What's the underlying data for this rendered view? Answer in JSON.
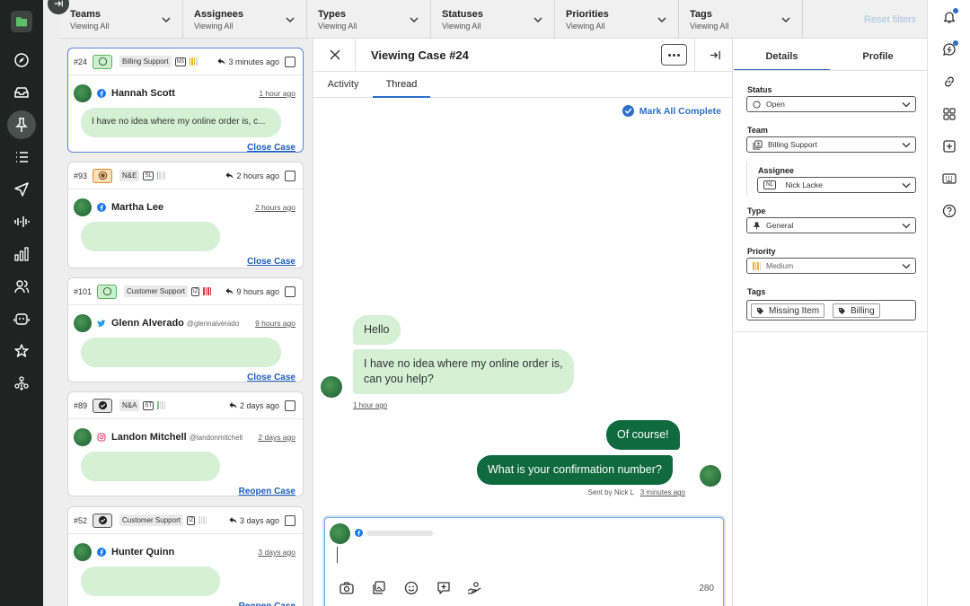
{
  "leftnav": {
    "items": [
      {
        "name": "folder-icon",
        "active": false
      },
      {
        "name": "compass-icon",
        "active": false
      },
      {
        "name": "inbox-icon",
        "active": false
      },
      {
        "name": "pin-icon",
        "active": true
      },
      {
        "name": "list-icon",
        "active": false
      },
      {
        "name": "send-icon",
        "active": false
      },
      {
        "name": "audio-wave-icon",
        "active": false
      },
      {
        "name": "bar-chart-icon",
        "active": false
      },
      {
        "name": "users-icon",
        "active": false
      },
      {
        "name": "bot-icon",
        "active": false
      },
      {
        "name": "star-badge-icon",
        "active": false
      },
      {
        "name": "network-icon",
        "active": false
      }
    ]
  },
  "filters": {
    "items": [
      {
        "title": "Teams",
        "value": "Viewing All"
      },
      {
        "title": "Assignees",
        "value": "Viewing All"
      },
      {
        "title": "Types",
        "value": "Viewing All"
      },
      {
        "title": "Statuses",
        "value": "Viewing All"
      },
      {
        "title": "Priorities",
        "value": "Viewing All"
      },
      {
        "title": "Tags",
        "value": "Viewing All"
      }
    ],
    "reset_label": "Reset filters"
  },
  "cases": [
    {
      "id": "#24",
      "status": "open",
      "team": "Billing Support",
      "initials": "NS",
      "priority_colors": [
        "#e8b530",
        "#e8b530",
        "#e8b530",
        "#d9d9d9"
      ],
      "reply_time": "3 minutes ago",
      "customer": "Hannah Scott",
      "handle": "",
      "channel": "facebook",
      "time": "1 hour ago",
      "preview": "I have no idea where my online order is, c...",
      "action": "Close Case"
    },
    {
      "id": "#93",
      "status": "pending",
      "team": "N&E",
      "initials": "SL",
      "priority_colors": [
        "#7fc28f",
        "#d9d9d9",
        "#d9d9d9",
        "#d9d9d9"
      ],
      "reply_time": "2 hours ago",
      "customer": "Martha Lee",
      "handle": "",
      "channel": "facebook",
      "time": "2 hours ago",
      "preview": "",
      "action": "Close Case"
    },
    {
      "id": "#101",
      "status": "open",
      "team": "Customer Support",
      "initials": "IZ",
      "priority_colors": [
        "#d9363e",
        "#d9363e",
        "#d9363e",
        "#d9363e"
      ],
      "reply_time": "9 hours ago",
      "customer": "Glenn Alverado",
      "handle": "@glennalverado",
      "channel": "twitter",
      "time": "9 hours ago",
      "preview": "",
      "action": "Close Case"
    },
    {
      "id": "#89",
      "status": "closed",
      "team": "N&A",
      "initials": "ST",
      "priority_colors": [
        "#7fc28f",
        "#d9d9d9",
        "#d9d9d9",
        "#d9d9d9"
      ],
      "reply_time": "2 days ago",
      "customer": "Landon Mitchell",
      "handle": "@landonmitchell",
      "channel": "instagram",
      "time": "2 days ago",
      "preview": "",
      "action": "Reopen Case"
    },
    {
      "id": "#52",
      "status": "closed",
      "team": "Customer Support",
      "initials": "IZ",
      "priority_colors": [
        "#d9d9d9",
        "#d9d9d9",
        "#d9d9d9",
        "#d9d9d9"
      ],
      "reply_time": "3 days ago",
      "customer": "Hunter Quinn",
      "handle": "",
      "channel": "facebook",
      "time": "3 days ago",
      "preview": "",
      "action": "Reopen Case"
    }
  ],
  "case_view": {
    "title": "Viewing Case #24",
    "tabs": [
      "Activity",
      "Thread"
    ],
    "active_tab": "Thread",
    "mark_all_label": "Mark All Complete",
    "thread": {
      "in_1": "Hello",
      "in_2_line1": "I have no idea where my online order is,",
      "in_2_line2": "can you help?",
      "in_time": "1 hour ago",
      "out_1": "Of course!",
      "out_2": "What is your confirmation number?",
      "out_sent_by": "Sent by Nick L",
      "out_time": "3 minutes ago"
    },
    "composer": {
      "char_count": "280"
    }
  },
  "details": {
    "tabs": [
      "Details",
      "Profile"
    ],
    "status_label": "Status",
    "status_value": "Open",
    "team_label": "Team",
    "team_value": "Billing Support",
    "assignee_label": "Assignee",
    "assignee_initials": "NL",
    "assignee_value": "Nick Lacke",
    "type_label": "Type",
    "type_value": "General",
    "priority_label": "Priority",
    "priority_value": "Medium",
    "tags_label": "Tags",
    "tags": [
      "Missing Item",
      "Billing"
    ]
  },
  "colors": {
    "accent": "#2c6fc9",
    "sidebar": "#1f2322",
    "bubble_in": "#d5f0d5",
    "bubble_out": "#0f6a3e"
  }
}
